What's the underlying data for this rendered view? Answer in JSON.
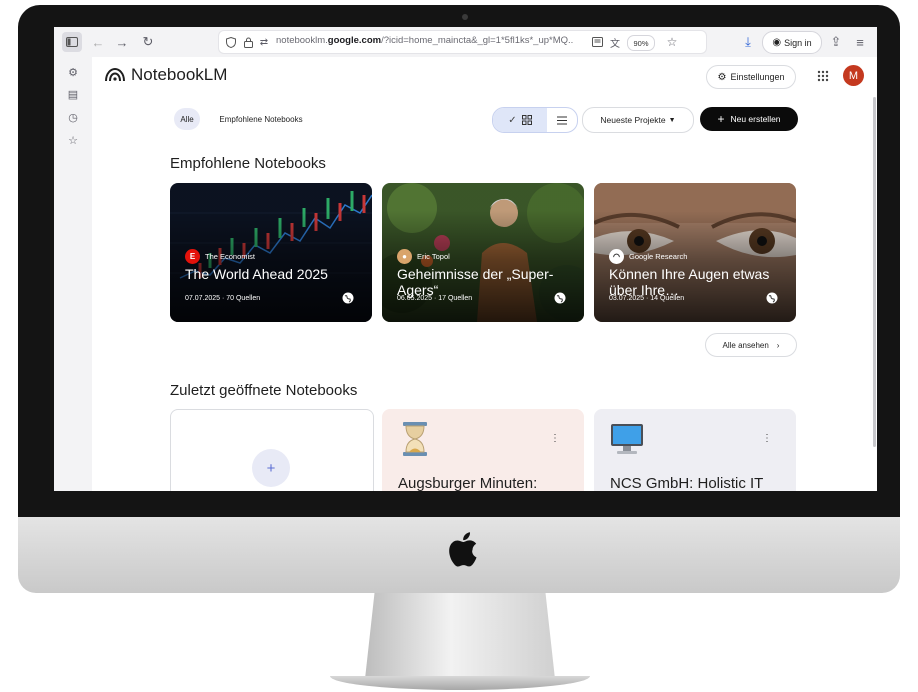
{
  "browser": {
    "url_prefix": "notebooklm.",
    "url_domain": "google.com",
    "url_rest": "/?icid=home_maincta&_gl=1*5fl1ks*_up*MQ..",
    "zoom": "90%",
    "signin_label": "Sign in",
    "icons": [
      "sidebar-toggle-icon",
      "back-icon",
      "forward-icon",
      "reload-icon",
      "shield-icon",
      "lock-icon",
      "permissions-icon",
      "reader-view-icon",
      "translate-icon",
      "bookmark-star-icon",
      "download-icon",
      "account-icon",
      "share-icon",
      "menu-icon",
      "extensions-icon",
      "tabs-icon",
      "history-icon",
      "bookmarks-icon"
    ]
  },
  "header": {
    "brand": "NotebookLM",
    "settings_label": "Einstellungen",
    "avatar_initial": "M"
  },
  "filters": {
    "all": "Alle",
    "featured": "Empfohlene Notebooks"
  },
  "toolbar": {
    "sort_label": "Neueste Projekte",
    "create_label": "Neu erstellen"
  },
  "featured": {
    "title": "Empfohlene Notebooks",
    "see_all": "Alle ansehen",
    "cards": [
      {
        "source": "The Economist",
        "title": "The World Ahead 2025",
        "meta": "07.07.2025 · 70 Quellen",
        "accent": "#e3120b"
      },
      {
        "source": "Eric Topol",
        "title": "Geheimnisse der „Super-Agers“",
        "meta": "06.05.2025 · 17 Quellen",
        "accent": "#d9a46b"
      },
      {
        "source": "Google Research",
        "title": "Können Ihre Augen etwas über Ihre…",
        "meta": "03.07.2025 · 14 Quellen",
        "accent": "#ffffff"
      }
    ]
  },
  "recent": {
    "title": "Zuletzt geöffnete Notebooks",
    "cards": [
      {
        "title": "Augsburger Minuten:",
        "icon": "hourglass-icon",
        "bg": "#f9ece9"
      },
      {
        "title": "NCS GmbH: Holistic IT",
        "icon": "computer-icon",
        "bg": "#eeeef3"
      }
    ]
  },
  "colors": {
    "create_button": "#0b0b0b",
    "chip_active": "#e8eaf6",
    "avatar": "#c4391f"
  }
}
